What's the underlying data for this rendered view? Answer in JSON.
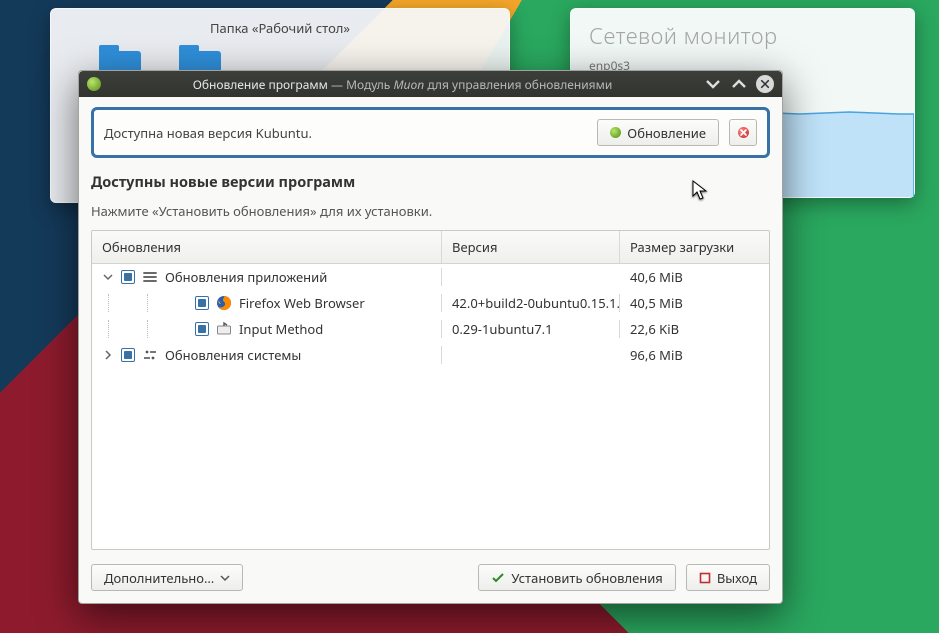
{
  "desktop": {
    "folder_widget_title": "Папка «Рабочий стол»",
    "network_widget_title": "Сетевой монитор",
    "network_interface": "enp0s3"
  },
  "window": {
    "title_main": "Обновление программ",
    "title_separator": " — ",
    "title_sub_prefix": "Модуль ",
    "title_sub_em": "Muon",
    "title_sub_suffix": " для управления обновлениями"
  },
  "banner": {
    "message": "Доступна новая версия Kubuntu.",
    "upgrade_label": "Обновление"
  },
  "heading": {
    "title": "Доступны новые версии программ",
    "subtitle": "Нажмите «Установить обновления» для их установки."
  },
  "columns": {
    "updates": "Обновления",
    "version": "Версия",
    "size": "Размер загрузки"
  },
  "groups": [
    {
      "icon": "apps",
      "label": "Обновления приложений",
      "size": "40,6 MiB",
      "expanded": true,
      "items": [
        {
          "icon": "firefox",
          "name": "Firefox Web Browser",
          "version": "42.0+build2-0ubuntu0.15.1…",
          "size": "40,5 MiB"
        },
        {
          "icon": "input",
          "name": "Input Method",
          "version": "0.29-1ubuntu7.1",
          "size": "22,6 KiB"
        }
      ]
    },
    {
      "icon": "system",
      "label": "Обновления системы",
      "size": "96,6 MiB",
      "expanded": false,
      "items": []
    }
  ],
  "footer": {
    "more_label": "Дополнительно…",
    "install_label": "Установить обновления",
    "quit_label": "Выход"
  }
}
